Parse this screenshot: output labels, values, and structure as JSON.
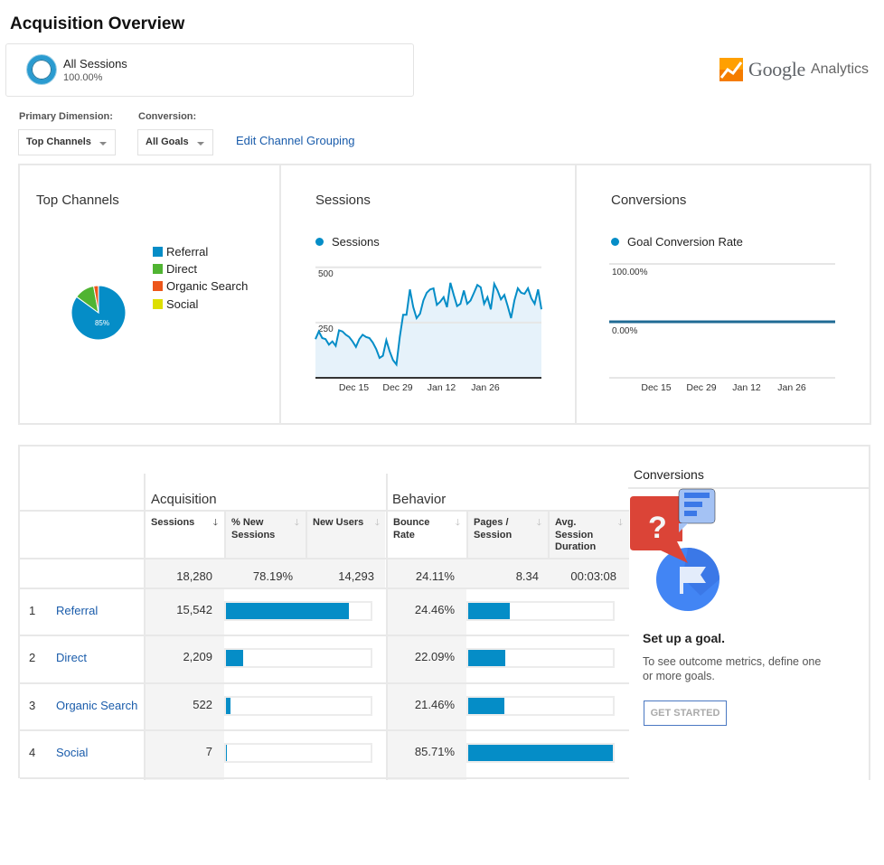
{
  "page": {
    "title": "Acquisition Overview"
  },
  "segment": {
    "name": "All Sessions",
    "percent": "100.00%",
    "color": "#2a9bd0"
  },
  "brand": {
    "google": "Google",
    "analytics": "Analytics",
    "icon": "google-analytics-logo"
  },
  "controls": {
    "primary_dimension_label": "Primary Dimension:",
    "primary_dimension_value": "Top Channels",
    "conversion_label": "Conversion:",
    "conversion_value": "All Goals",
    "edit_link": "Edit Channel Grouping"
  },
  "colors": {
    "accent": "#058dc7",
    "link": "#1a5cab",
    "referral": "#058dc7",
    "direct": "#50b432",
    "organic": "#ed561b",
    "social": "#dddf00"
  },
  "chart_data": [
    {
      "type": "pie",
      "title": "Top Channels",
      "legend": "right",
      "categories": [
        "Referral",
        "Direct",
        "Organic Search",
        "Social"
      ],
      "values": [
        15542,
        2209,
        522,
        7
      ],
      "colors": [
        "#058dc7",
        "#50b432",
        "#ed561b",
        "#dddf00"
      ],
      "labels": [
        "85%",
        "",
        "",
        ""
      ]
    },
    {
      "type": "area",
      "title": "Sessions",
      "series_name": "Sessions",
      "ylim": [
        0,
        500
      ],
      "yticks": [
        "500",
        "250"
      ],
      "xticks": [
        "Dec 15",
        "Dec 29",
        "Jan 12",
        "Jan 26"
      ],
      "xtick_index": [
        13,
        26,
        39,
        52
      ],
      "values": [
        175,
        210,
        180,
        175,
        150,
        165,
        145,
        215,
        210,
        195,
        185,
        165,
        140,
        175,
        195,
        185,
        180,
        160,
        130,
        90,
        100,
        170,
        120,
        80,
        60,
        185,
        285,
        285,
        400,
        320,
        270,
        290,
        350,
        385,
        400,
        405,
        330,
        345,
        365,
        320,
        430,
        375,
        325,
        335,
        395,
        335,
        350,
        385,
        420,
        410,
        335,
        365,
        310,
        425,
        395,
        355,
        375,
        325,
        270,
        350,
        405,
        385,
        380,
        405,
        360,
        335,
        400,
        310
      ],
      "grid": true
    },
    {
      "type": "line",
      "title": "Conversions",
      "series_name": "Goal Conversion Rate",
      "yticks": [
        "100.00%",
        "0.00%"
      ],
      "ylim": [
        0,
        100
      ],
      "xticks": [
        "Dec 15",
        "Dec 29",
        "Jan 12",
        "Jan 26"
      ],
      "values_constant": 0,
      "grid": true
    }
  ],
  "table": {
    "groups": [
      "Acquisition",
      "Behavior"
    ],
    "columns": [
      "Sessions",
      "% New Sessions",
      "New Users",
      "Bounce Rate",
      "Pages / Session",
      "Avg. Session Duration"
    ],
    "sorted_column": "Sessions",
    "totals": [
      "18,280",
      "78.19%",
      "14,293",
      "24.11%",
      "8.34",
      "00:03:08"
    ],
    "rows": [
      {
        "rank": "1",
        "channel": "Referral",
        "sessions": "15,542",
        "sessions_share": 0.85,
        "bounce_rate": "24.46%",
        "bounce_value": 24.46
      },
      {
        "rank": "2",
        "channel": "Direct",
        "sessions": "2,209",
        "sessions_share": 0.121,
        "bounce_rate": "22.09%",
        "bounce_value": 22.09
      },
      {
        "rank": "3",
        "channel": "Organic Search",
        "sessions": "522",
        "sessions_share": 0.029,
        "bounce_rate": "21.46%",
        "bounce_value": 21.46
      },
      {
        "rank": "4",
        "channel": "Social",
        "sessions": "7",
        "sessions_share": 0.0004,
        "bounce_rate": "85.71%",
        "bounce_value": 85.71
      }
    ]
  },
  "conversions_panel": {
    "title": "Conversions",
    "goal_title": "Set up a goal.",
    "goal_desc": "To see outcome metrics, define one or more goals.",
    "cta": "GET STARTED"
  }
}
